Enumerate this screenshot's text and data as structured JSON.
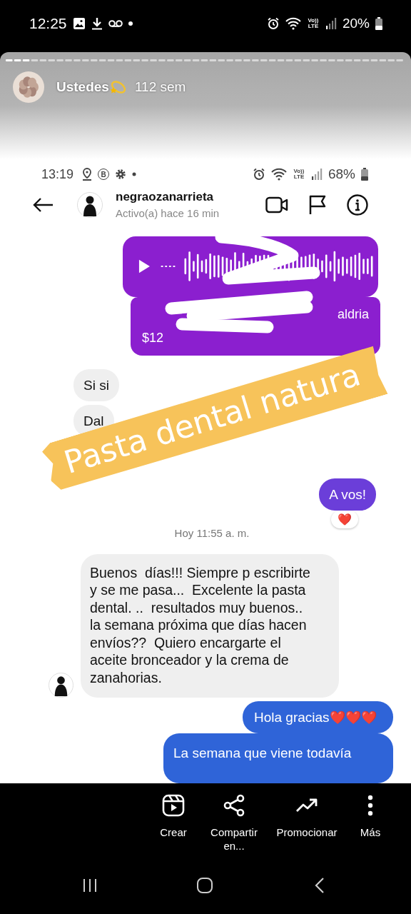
{
  "status_bar": {
    "time": "12:25",
    "network": "Vo)) LTE",
    "battery": "20%"
  },
  "story": {
    "author": "Ustedes",
    "age": "112 sem"
  },
  "chat": {
    "status_bar": {
      "time": "13:19",
      "badge": "B",
      "network": "Vo)) LTE",
      "battery": "68%"
    },
    "contact": {
      "name": "negraozanarrieta",
      "activity": "Activo(a) hace 16 min"
    },
    "messages": [
      {
        "kind": "audio",
        "outgoing": true,
        "color": "#8b1fcf"
      },
      {
        "kind": "card",
        "outgoing": true,
        "color": "#8b1fcf",
        "title": "aldria",
        "price": "$12"
      },
      {
        "kind": "text",
        "outgoing": false,
        "avatar": false,
        "text": "Si si"
      },
      {
        "kind": "text",
        "outgoing": false,
        "avatar": false,
        "text": "Dal"
      },
      {
        "kind": "text",
        "outgoing": true,
        "color": "#6b3ed9",
        "text": "A vos!",
        "reaction": "❤️"
      },
      {
        "kind": "time",
        "text": "Hoy 11:55 a. m."
      },
      {
        "kind": "text",
        "outgoing": false,
        "avatar": true,
        "text": "Buenos  días!!! Siempre p escribirte y se me pasa...  Excelente la pasta dental. ..  resultados muy buenos.. la semana próxima que días hacen envíos??  Quiero encargarte el aceite bronceador y la crema de zanahorias."
      },
      {
        "kind": "text",
        "outgoing": true,
        "color": "#2f64d8",
        "text": "Hola gracias",
        "emoji": "❤️❤️❤️"
      },
      {
        "kind": "text",
        "outgoing": true,
        "color": "#2f64d8",
        "text": "La semana que viene todavía"
      }
    ]
  },
  "sticker": {
    "text": "Pasta dental natura"
  },
  "actions": [
    {
      "label": "Crear"
    },
    {
      "label": "Compartir en..."
    },
    {
      "label": "Promocionar"
    },
    {
      "label": "Más"
    }
  ]
}
